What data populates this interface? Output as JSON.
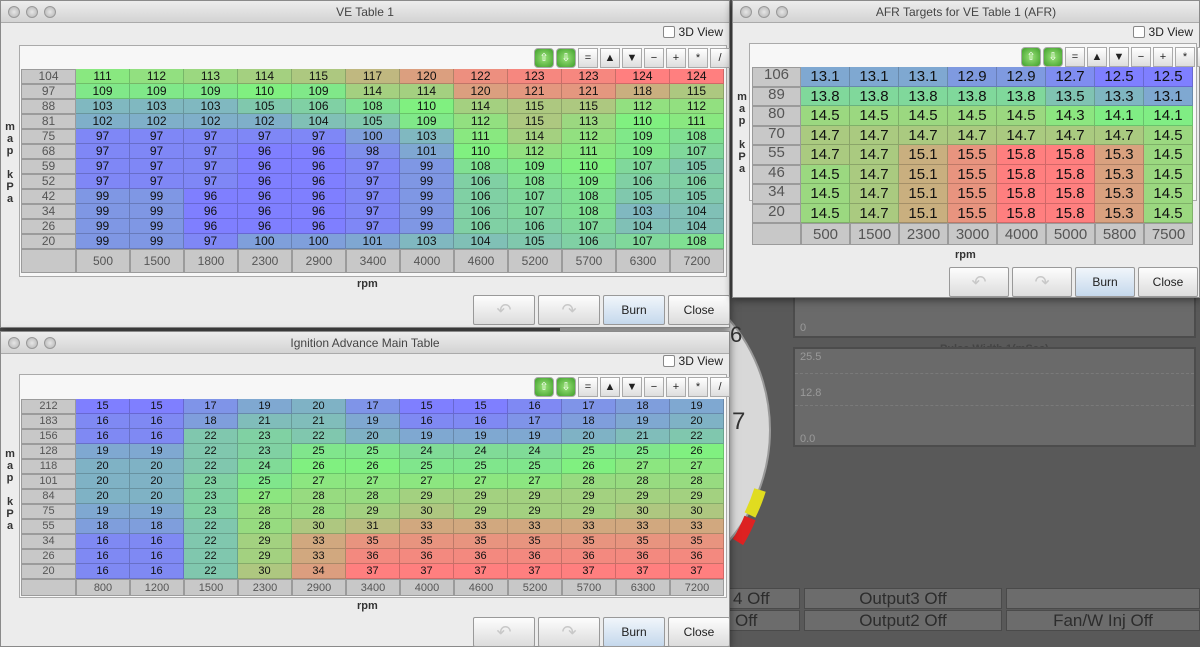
{
  "palette": {
    "low": "#7f7fff",
    "mid": "#80f080",
    "high": "#ff7f7f"
  },
  "toolbar_icons": [
    "increase-icon",
    "decrease-icon",
    "equals-icon",
    "up-icon",
    "down-icon",
    "minus-icon",
    "plus-icon",
    "multiply-icon",
    "pencil-icon"
  ],
  "toolbar_glyphs": [
    "⇧",
    "⇩",
    "=",
    "▲",
    "▼",
    "−",
    "+",
    "*",
    "/"
  ],
  "common": {
    "view3d": "3D View",
    "burn": "Burn",
    "close": "Close",
    "undo": "↶",
    "redo": "↷",
    "xaxis": "rpm",
    "yaxis": [
      "m",
      "a",
      "p",
      "",
      "k",
      "P",
      "a"
    ]
  },
  "ve": {
    "title": "VE Table 1",
    "y": [
      "104",
      "97",
      "88",
      "81",
      "75",
      "68",
      "59",
      "52",
      "42",
      "34",
      "26",
      "20"
    ],
    "x": [
      "500",
      "1500",
      "1800",
      "2300",
      "2900",
      "3400",
      "4000",
      "4600",
      "5200",
      "5700",
      "6300",
      "7200"
    ],
    "rows": [
      [
        111,
        112,
        113,
        114,
        115,
        117,
        120,
        122,
        123,
        123,
        124,
        124
      ],
      [
        109,
        109,
        109,
        110,
        109,
        114,
        114,
        120,
        121,
        121,
        118,
        115
      ],
      [
        103,
        103,
        103,
        105,
        106,
        108,
        110,
        114,
        115,
        115,
        112,
        112
      ],
      [
        102,
        102,
        102,
        102,
        104,
        105,
        109,
        112,
        115,
        113,
        110,
        111
      ],
      [
        97,
        97,
        97,
        97,
        97,
        100,
        103,
        111,
        114,
        112,
        109,
        108
      ],
      [
        97,
        97,
        97,
        96,
        96,
        98,
        101,
        110,
        112,
        111,
        109,
        107
      ],
      [
        97,
        97,
        97,
        96,
        96,
        97,
        99,
        108,
        109,
        110,
        107,
        105
      ],
      [
        97,
        97,
        97,
        96,
        96,
        97,
        99,
        106,
        108,
        109,
        106,
        106
      ],
      [
        99,
        99,
        96,
        96,
        96,
        97,
        99,
        106,
        107,
        108,
        105,
        105
      ],
      [
        99,
        99,
        96,
        96,
        96,
        97,
        99,
        106,
        107,
        108,
        103,
        104
      ],
      [
        99,
        99,
        96,
        96,
        96,
        97,
        99,
        106,
        106,
        107,
        104,
        104
      ],
      [
        99,
        99,
        97,
        100,
        100,
        101,
        103,
        104,
        105,
        106,
        107,
        108
      ]
    ]
  },
  "afr": {
    "title": "AFR Targets for VE Table 1 (AFR)",
    "y": [
      "106",
      "89",
      "80",
      "70",
      "55",
      "46",
      "34",
      "20"
    ],
    "x": [
      "500",
      "1500",
      "2300",
      "3000",
      "4000",
      "5000",
      "5800",
      "7500"
    ],
    "rows": [
      [
        "13.1",
        "13.1",
        "13.1",
        "12.9",
        "12.9",
        "12.7",
        "12.5",
        "12.5"
      ],
      [
        "13.8",
        "13.8",
        "13.8",
        "13.8",
        "13.8",
        "13.5",
        "13.3",
        "13.1"
      ],
      [
        "14.5",
        "14.5",
        "14.5",
        "14.5",
        "14.5",
        "14.3",
        "14.1",
        "14.1"
      ],
      [
        "14.7",
        "14.7",
        "14.7",
        "14.7",
        "14.7",
        "14.7",
        "14.7",
        "14.5"
      ],
      [
        "14.7",
        "14.7",
        "15.1",
        "15.5",
        "15.8",
        "15.8",
        "15.3",
        "14.5"
      ],
      [
        "14.5",
        "14.7",
        "15.1",
        "15.5",
        "15.8",
        "15.8",
        "15.3",
        "14.5"
      ],
      [
        "14.5",
        "14.7",
        "15.1",
        "15.5",
        "15.8",
        "15.8",
        "15.3",
        "14.5"
      ],
      [
        "14.5",
        "14.7",
        "15.1",
        "15.5",
        "15.8",
        "15.8",
        "15.3",
        "14.5"
      ]
    ]
  },
  "ign": {
    "title": "Ignition Advance Main Table",
    "y": [
      "212",
      "183",
      "156",
      "128",
      "118",
      "101",
      "84",
      "75",
      "55",
      "34",
      "26",
      "20"
    ],
    "x": [
      "800",
      "1200",
      "1500",
      "2300",
      "2900",
      "3400",
      "4000",
      "4600",
      "5200",
      "5700",
      "6300",
      "7200"
    ],
    "rows": [
      [
        15,
        15,
        17,
        19,
        20,
        17,
        15,
        15,
        16,
        17,
        18,
        19
      ],
      [
        16,
        16,
        18,
        21,
        21,
        19,
        16,
        16,
        17,
        18,
        19,
        20
      ],
      [
        16,
        16,
        22,
        23,
        22,
        20,
        19,
        19,
        19,
        20,
        21,
        22
      ],
      [
        19,
        19,
        22,
        23,
        25,
        25,
        24,
        24,
        24,
        25,
        25,
        26
      ],
      [
        20,
        20,
        22,
        24,
        26,
        26,
        25,
        25,
        25,
        26,
        27,
        27
      ],
      [
        20,
        20,
        23,
        25,
        27,
        27,
        27,
        27,
        27,
        28,
        28,
        28
      ],
      [
        20,
        20,
        23,
        27,
        28,
        28,
        29,
        29,
        29,
        29,
        29,
        29
      ],
      [
        19,
        19,
        23,
        28,
        28,
        29,
        30,
        29,
        29,
        29,
        30,
        30
      ],
      [
        18,
        18,
        22,
        28,
        30,
        31,
        33,
        33,
        33,
        33,
        33,
        33
      ],
      [
        16,
        16,
        22,
        29,
        33,
        35,
        35,
        35,
        35,
        35,
        35,
        35
      ],
      [
        16,
        16,
        22,
        29,
        33,
        36,
        36,
        36,
        36,
        36,
        36,
        36
      ],
      [
        16,
        16,
        22,
        30,
        34,
        37,
        37,
        37,
        37,
        37,
        37,
        37
      ]
    ]
  },
  "dashboard": {
    "gauge_numbers": [
      "6",
      "7"
    ],
    "graph1_min": "0",
    "graph2_title": "Pulse Width 1(mSec)",
    "graph2_ticks": [
      "25.5",
      "12.8",
      "0.0"
    ],
    "outputs_row1": [
      "4 Off",
      "Output3 Off",
      ""
    ],
    "outputs_row2": [
      "Off",
      "Output2 Off",
      "Fan/W Inj Off"
    ]
  }
}
